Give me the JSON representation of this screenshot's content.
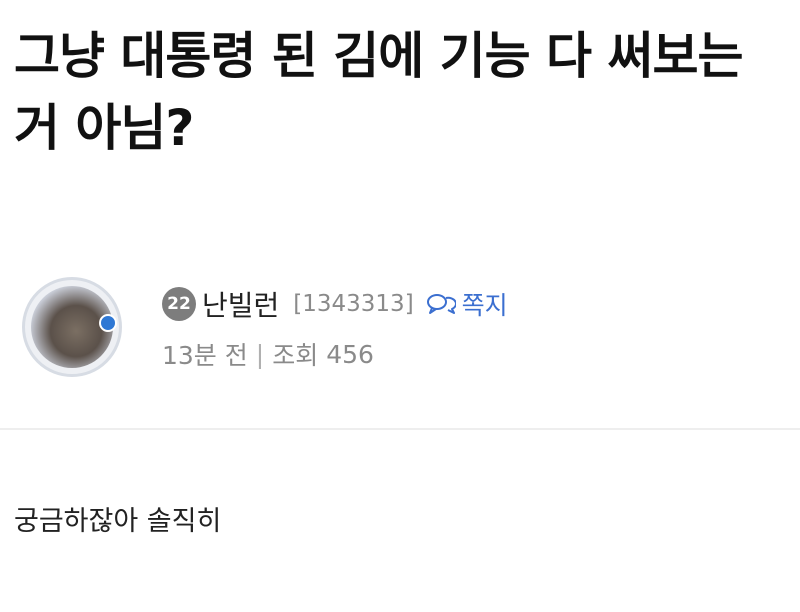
{
  "post": {
    "title": "그냥 대통령 된 김에 기능 다 써보는거 아님?",
    "author": {
      "level": "22",
      "nickname": "난빌런",
      "user_id": "[1343313]",
      "message_label": "쪽지"
    },
    "meta": {
      "time": "13분 전",
      "separator": "|",
      "views_label": "조회",
      "views": "456"
    },
    "body": "궁금하잖아 솔직히"
  },
  "colors": {
    "accent": "#3b6fd0",
    "muted": "#8a8a8a",
    "level_badge": "#7d7d7d"
  },
  "icons": {
    "message": "chat-bubbles-icon",
    "avatar_badge": "verified-dot-icon"
  }
}
